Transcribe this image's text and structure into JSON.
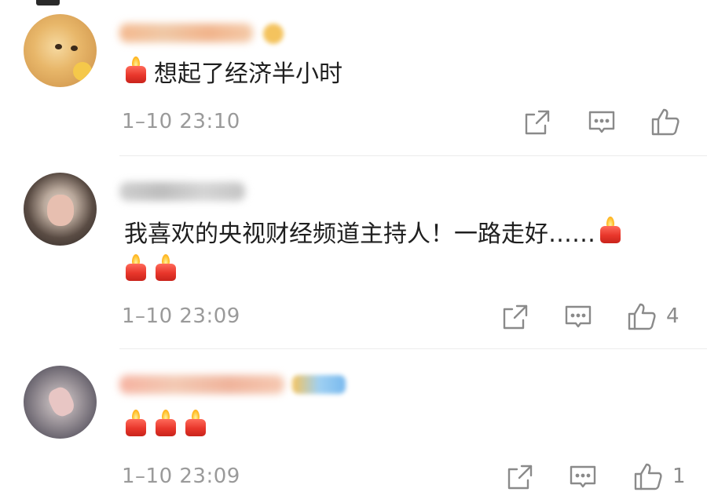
{
  "comments": [
    {
      "text": "想起了经济半小时",
      "time": "1–10 23:10",
      "likes": ""
    },
    {
      "text_line1": "我喜欢的央视财经频道主持人！一路走好……",
      "time": "1–10 23:09",
      "likes": "4"
    },
    {
      "time": "1–10 23:09",
      "likes": "1"
    }
  ],
  "icons": {
    "share": "share-icon",
    "comment": "comment-icon",
    "like": "thumbs-up-icon",
    "candle": "candle-emoji"
  },
  "colors": {
    "text": "#1f1f1f",
    "meta": "#9a9a9a",
    "icon": "#8a8a8a",
    "candle": "#e8362b"
  }
}
